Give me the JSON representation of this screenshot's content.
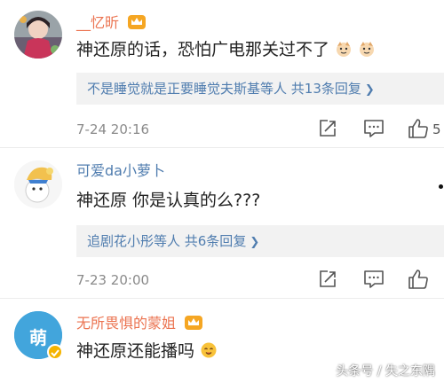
{
  "comments": [
    {
      "username": "__忆昕",
      "text": "神还原的话，恐怕广电那关过不了",
      "reply_summary": "不是睡觉就是正要睡觉夫斯基等人 共13条回复",
      "timestamp": "7-24 20:16",
      "like_count": "5"
    },
    {
      "username": "可爱da小萝卜",
      "text": "神还原 你是认真的么???",
      "reply_summary": "追剧花小彤等人 共6条回复",
      "timestamp": "7-23 20:00"
    },
    {
      "username": "无所畏惧的蒙姐",
      "text": "神还原还能播吗",
      "avatar_label": "萌"
    }
  ],
  "watermark": "头条号 / 失之东隅",
  "icons": {
    "vip_badge": "crown-badge-icon",
    "share": "share-icon",
    "comment": "comment-icon",
    "like": "thumbs-up-icon",
    "reply_chevron": "chevron-right-icon",
    "emoji": "face-emoji-icon"
  },
  "colors": {
    "username_orange": "#eb7350",
    "username_blue": "#507daf",
    "link_blue": "#507daf",
    "reply_bg": "#f2f2f2"
  }
}
